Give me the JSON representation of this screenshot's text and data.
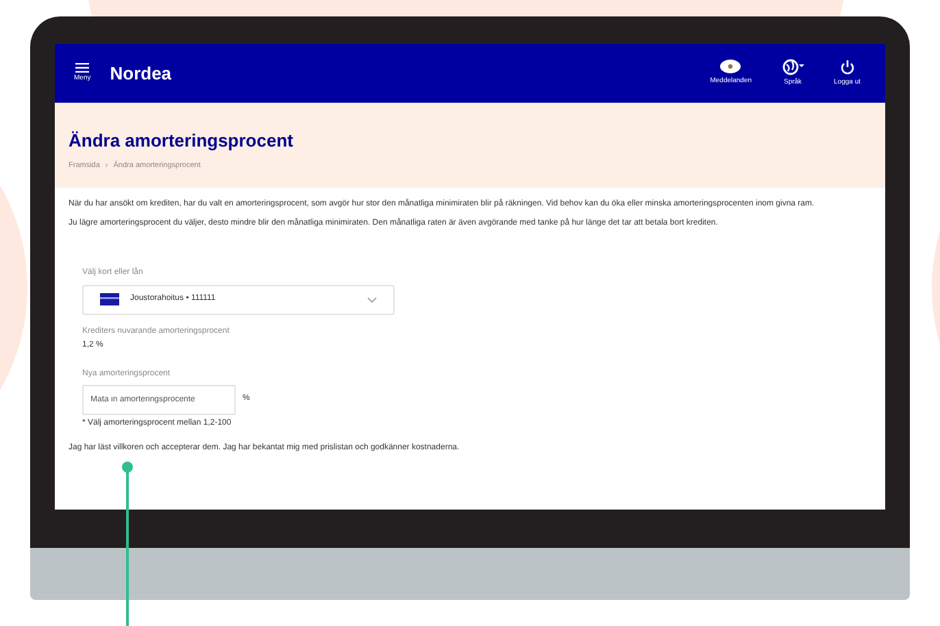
{
  "header": {
    "menu_label": "Meny",
    "logo": "Nordea",
    "actions": [
      {
        "kind": "messages",
        "label": "Meddelanden"
      },
      {
        "kind": "language",
        "label": "Språk"
      },
      {
        "kind": "logout",
        "label": "Logga ut"
      }
    ]
  },
  "title": "Ändra amorteringsprocent",
  "breadcrumb": [
    "Framsida",
    "›",
    "Ändra amorteringsprocent"
  ],
  "paragraphs": [
    "När du har ansökt om krediten, har du valt en amorteringsprocent, som avgör hur stor den månatliga minimiraten blir på räkningen. Vid behov kan du öka eller minska amorteringsprocenten inom givna ram.",
    "Ju lägre amorteringsprocent du väljer, desto mindre blir den månatliga minimiraten. Den månatliga raten är även avgörande med tanke på hur länge det tar att betala bort krediten."
  ],
  "account_select": {
    "label": "Välj kort eller lån",
    "value": "Joustorahoitus • 111111"
  },
  "current": {
    "label": "Krediters nuvarande amorteringsprocent",
    "value": "1,2 %"
  },
  "new_rate": {
    "label": "Nya amorteringsprocent",
    "placeholder": "Mata in amorteringsprocente",
    "unit": "%",
    "hint": "* Välj amorteringsprocent mellan 1,2-100"
  },
  "terms": "Jag har läst villkoren och accepterar dem. Jag har bekantat mig med prislistan och godkänner kostnaderna."
}
